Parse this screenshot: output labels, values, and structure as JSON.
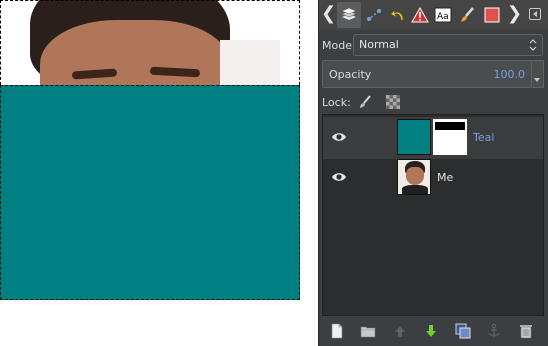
{
  "canvas": {
    "layers_visible": [
      "photo",
      "teal"
    ],
    "teal_color": "#008080"
  },
  "dock": {
    "tabs": [
      {
        "icon": "layers-icon",
        "active": true
      },
      {
        "icon": "channels-icon",
        "active": false
      },
      {
        "icon": "undo-history-icon",
        "active": false
      },
      {
        "icon": "error-console-icon",
        "active": false
      },
      {
        "icon": "fonts-icon",
        "active": false
      },
      {
        "icon": "brushes-icon",
        "active": false
      },
      {
        "icon": "patterns-icon",
        "active": false
      }
    ],
    "mode_label": "Mode:",
    "mode_value": "Normal",
    "opacity_label": "Opacity",
    "opacity_value": "100.0",
    "lock_label": "Lock:",
    "layers": [
      {
        "name": "Teal",
        "selected": true,
        "visible": true,
        "has_mask": true,
        "color": "#008080"
      },
      {
        "name": "Me",
        "selected": false,
        "visible": true,
        "has_mask": false
      }
    ],
    "bottom_buttons": [
      "new-layer-icon",
      "new-layer-group-icon",
      "raise-layer-icon",
      "lower-layer-icon",
      "duplicate-layer-icon",
      "anchor-layer-icon",
      "delete-layer-icon"
    ]
  },
  "colors": {
    "accent_blue": "#7a9fe0",
    "panel_bg": "#3c3f41",
    "list_bg": "#2b2d2e"
  }
}
